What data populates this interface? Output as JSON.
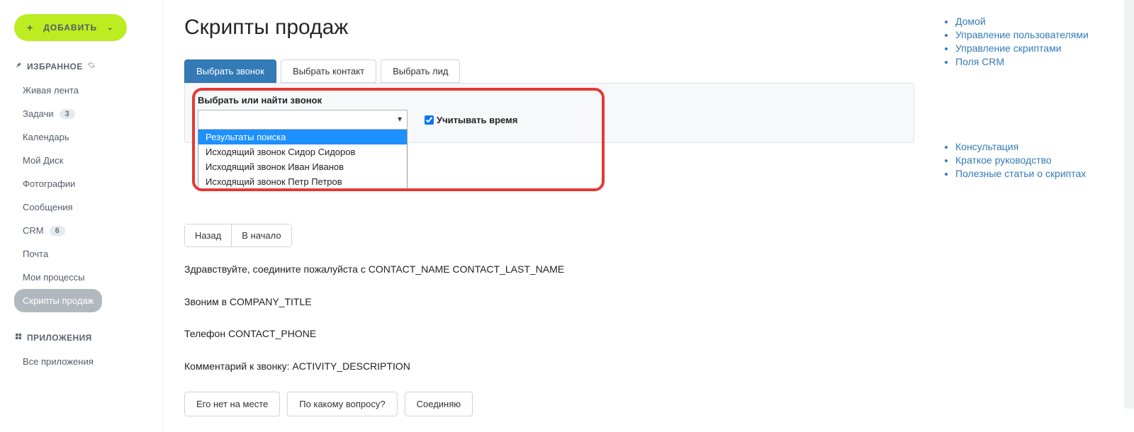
{
  "sidebar": {
    "add_button": "ДОБАВИТЬ",
    "favorites_header": "ИЗБРАННОЕ",
    "items": [
      {
        "label": "Живая лента"
      },
      {
        "label": "Задачи",
        "badge": "3"
      },
      {
        "label": "Календарь"
      },
      {
        "label": "Мой Диск"
      },
      {
        "label": "Фотографии"
      },
      {
        "label": "Сообщения"
      },
      {
        "label": "CRM",
        "badge": "6"
      },
      {
        "label": "Почта"
      },
      {
        "label": "Мои процессы"
      },
      {
        "label": "Скрипты продаж",
        "active": true
      }
    ],
    "apps_header": "ПРИЛОЖЕНИЯ",
    "apps_items": [
      {
        "label": "Все приложения"
      }
    ]
  },
  "page": {
    "title": "Скрипты продаж",
    "tabs": {
      "call": "Выбрать звонок",
      "contact": "Выбрать контакт",
      "lead": "Выбрать лид"
    },
    "select_block": {
      "label": "Выбрать или найти звонок",
      "options": {
        "header": "Результаты поиска",
        "o1": "Исходящий звонок Сидор Сидоров",
        "o2": "Исходящий звонок Иван Иванов",
        "o3": "Исходящий звонок Петр Петров"
      },
      "time_checkbox": "Учитывать время"
    },
    "back_group": {
      "back": "Назад",
      "start": "В начало"
    },
    "body": {
      "l1": "Здравствуйте, соедините пожалуйста с CONTACT_NAME CONTACT_LAST_NAME",
      "l2": "Звоним в COMPANY_TITLE",
      "l3": "Телефон CONTACT_PHONE",
      "l4": "Комментарий к звонку: ACTIVITY_DESCRIPTION"
    },
    "actions": {
      "a1": "Его нет на месте",
      "a2": "По какому вопросу?",
      "a3": "Соединяю"
    }
  },
  "right": {
    "block1": {
      "l1": "Домой",
      "l2": "Управление пользователями",
      "l3": "Управление скриптами",
      "l4": "Поля CRM"
    },
    "block2": {
      "l1": "Консультация",
      "l2": "Краткое руководство",
      "l3": "Полезные статьи о скриптах"
    }
  }
}
